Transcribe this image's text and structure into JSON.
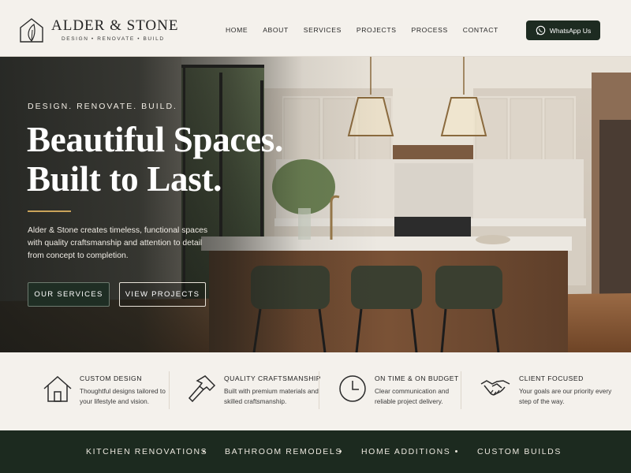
{
  "header": {
    "brand": "ALDER & STONE",
    "tagline": "DESIGN • RENOVATE • BUILD",
    "nav": [
      "HOME",
      "ABOUT",
      "SERVICES",
      "PROJECTS",
      "PROCESS",
      "CONTACT"
    ],
    "cta_label": "WhatsApp Us"
  },
  "hero": {
    "eyebrow": "DESIGN. RENOVATE. BUILD.",
    "headline_line1": "Beautiful Spaces.",
    "headline_line2": "Built to Last.",
    "intro": "Alder & Stone creates timeless, functional spaces with quality craftsmanship and attention to detail from concept to completion.",
    "primary_button": "OUR SERVICES",
    "secondary_button": "VIEW PROJECTS"
  },
  "features": [
    {
      "title": "CUSTOM DESIGN",
      "desc": "Thoughtful designs tailored to your lifestyle and vision.",
      "icon": "house-icon"
    },
    {
      "title": "QUALITY CRAFTSMANSHIP",
      "desc": "Built with premium materials and skilled craftsmanship.",
      "icon": "hammer-icon"
    },
    {
      "title": "ON TIME & ON BUDGET",
      "desc": "Clear communication and reliable project delivery.",
      "icon": "clock-icon"
    },
    {
      "title": "CLIENT FOCUSED",
      "desc": "Your goals are our priority every step of the way.",
      "icon": "handshake-icon"
    }
  ],
  "services_bar": [
    "KITCHEN RENOVATIONS",
    "BATHROOM REMODELS",
    "HOME ADDITIONS",
    "CUSTOM BUILDS"
  ],
  "colors": {
    "dark_green": "#1c2a1f",
    "gold": "#c9a35a",
    "cream": "#f4f1ec"
  }
}
